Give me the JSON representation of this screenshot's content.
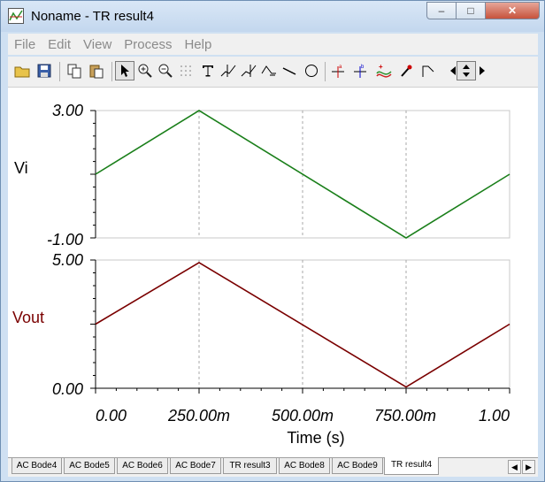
{
  "window": {
    "title": "Noname - TR result4"
  },
  "titlebar_buttons": {
    "minimize": "–",
    "maximize": "□",
    "close": "✕"
  },
  "menu": [
    "File",
    "Edit",
    "View",
    "Process",
    "Help"
  ],
  "toolbar": [
    {
      "name": "open-icon"
    },
    {
      "name": "save-icon"
    },
    {
      "name": "copy-icon"
    },
    {
      "name": "paste-icon"
    },
    {
      "name": "pointer-icon"
    },
    {
      "name": "zoom-in-icon"
    },
    {
      "name": "zoom-out-icon"
    },
    {
      "name": "grid-icon"
    },
    {
      "name": "text-icon"
    },
    {
      "name": "cursor-a-icon"
    },
    {
      "name": "cursor-b-icon"
    },
    {
      "name": "cursor-label-icon"
    },
    {
      "name": "line-icon"
    },
    {
      "name": "circle-icon"
    },
    {
      "name": "marker-a-icon"
    },
    {
      "name": "marker-b-icon"
    },
    {
      "name": "add-curve-icon"
    },
    {
      "name": "eyedropper-icon"
    },
    {
      "name": "flag-icon"
    },
    {
      "name": "arrow-left-icon"
    },
    {
      "name": "arrow-updown-icon"
    },
    {
      "name": "arrow-right-icon"
    }
  ],
  "chart_data": [
    {
      "type": "line",
      "ylabel": "Vi",
      "ylabel_color": "#000000",
      "ytick_labels": [
        "3.00",
        "-1.00"
      ],
      "ylim": [
        -1,
        3
      ],
      "xlim": [
        0,
        1
      ],
      "grid": true,
      "series": [
        {
          "color": "#1a7f1a",
          "x": [
            0,
            0.25,
            0.75,
            1
          ],
          "y": [
            1.0,
            3.0,
            -1.0,
            1.0
          ]
        }
      ]
    },
    {
      "type": "line",
      "ylabel": "Vout",
      "ylabel_color": "#7a0000",
      "ytick_labels": [
        "5.00",
        "0.00"
      ],
      "ylim": [
        0,
        5
      ],
      "xlim": [
        0,
        1
      ],
      "grid": true,
      "xlabel": "Time (s)",
      "xtick_labels": [
        "0.00",
        "250.00m",
        "500.00m",
        "750.00m",
        "1.00"
      ],
      "series": [
        {
          "color": "#7a0000",
          "x": [
            0,
            0.25,
            0.75,
            1
          ],
          "y": [
            2.5,
            4.9,
            0.05,
            2.5
          ]
        }
      ]
    }
  ],
  "tabs": [
    {
      "label": "AC Bode4"
    },
    {
      "label": "AC Bode5"
    },
    {
      "label": "AC Bode6"
    },
    {
      "label": "AC Bode7"
    },
    {
      "label": "TR result3"
    },
    {
      "label": "AC Bode8"
    },
    {
      "label": "AC Bode9"
    },
    {
      "label": "TR result4",
      "active": true
    }
  ],
  "tab_scroll": {
    "left": "◀",
    "right": "▶"
  }
}
